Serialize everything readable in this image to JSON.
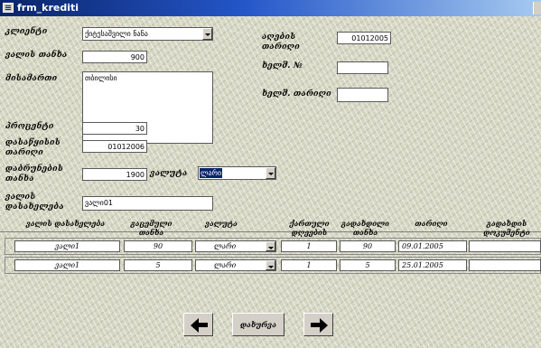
{
  "window": {
    "title": "frm_krediti"
  },
  "form": {
    "client": {
      "label": "კლიენტი",
      "value": "ქიტესაშვილი ნანა"
    },
    "debt_amount": {
      "label": "ვალის თანხა",
      "value": "900"
    },
    "address": {
      "label": "მისამართი",
      "value": "თბილისი"
    },
    "percent": {
      "label": "პროცენტი",
      "value": "30"
    },
    "start_date": {
      "label": "დასაწყისის თარიღი",
      "value": "01012006"
    },
    "installment": {
      "label": "დაბრუნების თანხა",
      "value": "1900"
    },
    "currency": {
      "label": "ვალუტა",
      "value": "ლარი"
    },
    "debt_name": {
      "label": "ვალის დასახელება",
      "value": "ვალი01"
    },
    "issue_date": {
      "label": "აღების თარიღი",
      "value": "01012005"
    },
    "doc_no": {
      "label": "ხელშ. №",
      "value": ""
    },
    "doc_date": {
      "label": "ხელშ. თარიღი",
      "value": ""
    }
  },
  "grid": {
    "headers": [
      "ვალის დასახელება",
      "გაცემული თანხა",
      "ვალუტა",
      "ქართული დღეების",
      "გადახდილი თანხა",
      "თარიღი",
      "გადახდის დოკუმენტი"
    ],
    "rows": [
      {
        "name": "ვალი1",
        "given": "90",
        "currency": "ლარი",
        "days": "1",
        "paid": "90",
        "date": "09.01.2005"
      },
      {
        "name": "ვალი1",
        "given": "5",
        "currency": "ლარი",
        "days": "1",
        "paid": "5",
        "date": "25.01.2005"
      }
    ]
  },
  "footer": {
    "close_label": "დახურვა"
  },
  "icons": {
    "prev": "arrow-left-icon",
    "next": "arrow-right-icon",
    "dropdown": "chevron-down-icon"
  },
  "colors": {
    "titlebar": "#0a246a",
    "form_bg": "#d5d6c2",
    "selection": "#0a246a"
  }
}
